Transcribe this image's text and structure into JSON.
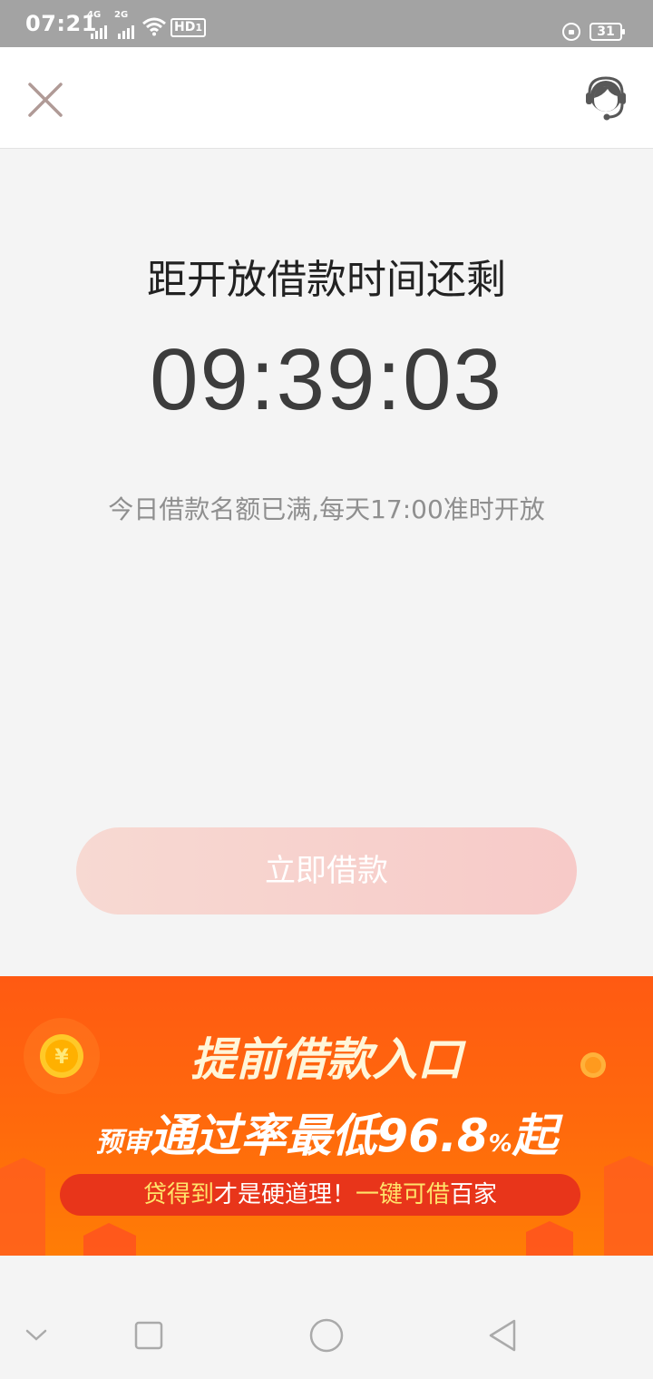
{
  "status_bar": {
    "time": "07:21",
    "sim1": "4G",
    "sim2": "2G",
    "hd": "HD",
    "hd_sim": "1",
    "battery": "31",
    "icons": [
      "signal-icon",
      "signal-icon",
      "wifi-icon",
      "hd-voice-icon",
      "rotation-lock-icon",
      "battery-icon"
    ]
  },
  "header": {
    "close_icon": "close-icon",
    "support_icon": "customer-service-icon"
  },
  "main": {
    "heading": "距开放借款时间还剩",
    "countdown": "09:39:03",
    "notice": "今日借款名额已满,每天17:00准时开放",
    "button_label": "立即借款"
  },
  "banner": {
    "title": "提前借款入口",
    "sub_prefix": "预审",
    "sub_main": "通过率最低96.8",
    "sub_percent": "%",
    "sub_suffix": "起",
    "pill_hl1": "贷得到",
    "pill_text1": "才是硬道理！",
    "pill_hl2": "一键可借",
    "pill_text2": "百家"
  },
  "navbar": {
    "icons": [
      "collapse-icon",
      "recents-icon",
      "home-icon",
      "back-icon"
    ]
  },
  "colors": {
    "status_bar": "#a3a3a3",
    "background": "#f4f4f4",
    "button_start": "#f7d9d2",
    "button_end": "#f7cac8",
    "banner": "#ff6a0c",
    "pill": "#e8351a",
    "highlight": "#ffe36a"
  }
}
